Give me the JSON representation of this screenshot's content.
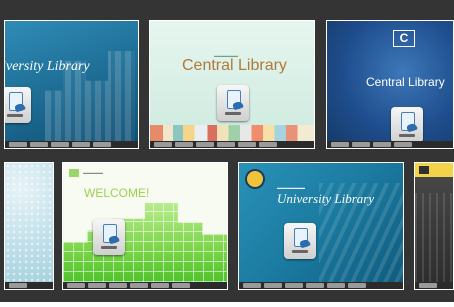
{
  "gallery": {
    "thumbnails": [
      {
        "title": "University Library",
        "accent": "#1d6a8f"
      },
      {
        "title": "Central Library",
        "accent": "#cfe9dd"
      },
      {
        "title": "Central Library",
        "badge": "C",
        "accent": "#1a4b8c"
      },
      {
        "title": "",
        "accent": "#c8e3ec"
      },
      {
        "title": "WELCOME!",
        "accent": "#7fd44a"
      },
      {
        "title": "University Library",
        "accent": "#1d7a9e"
      },
      {
        "title": "",
        "accent": "#f3d34a"
      }
    ]
  }
}
